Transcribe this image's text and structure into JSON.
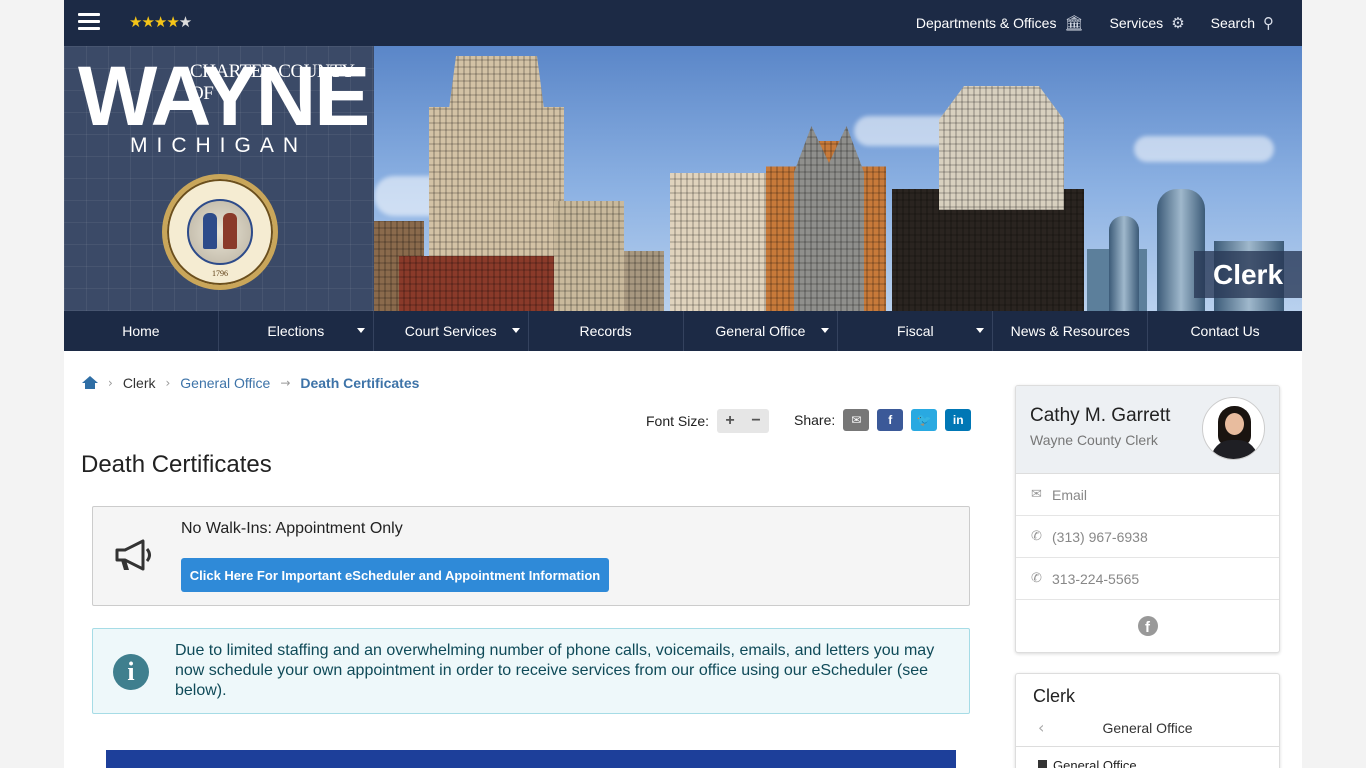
{
  "topbar": {
    "rating": {
      "stars": 4.5,
      "max": 5
    },
    "links": [
      {
        "label": "Departments & Offices",
        "icon": "bank-icon"
      },
      {
        "label": "Services",
        "icon": "gears-icon"
      },
      {
        "label": "Search",
        "icon": "search-icon"
      }
    ]
  },
  "hero": {
    "logo_charter": "CHARTER COUNTY OF",
    "logo_wayne": "WAYNE",
    "logo_michigan": "MICHIGAN",
    "seal_year": "1796",
    "page_label": "Clerk"
  },
  "mainnav": {
    "items": [
      {
        "label": "Home",
        "dropdown": false
      },
      {
        "label": "Elections",
        "dropdown": true
      },
      {
        "label": "Court Services",
        "dropdown": true
      },
      {
        "label": "Records",
        "dropdown": false
      },
      {
        "label": "General Office",
        "dropdown": true
      },
      {
        "label": "Fiscal",
        "dropdown": true
      },
      {
        "label": "News & Resources",
        "dropdown": false
      },
      {
        "label": "Contact Us",
        "dropdown": false
      }
    ]
  },
  "breadcrumb": {
    "items": [
      "Clerk",
      "General Office",
      "Death Certificates"
    ]
  },
  "tools": {
    "font_size_label": "Font Size:",
    "plus": "+",
    "minus": "−",
    "share_label": "Share:",
    "share_buttons": [
      {
        "name": "email-icon",
        "glyph": "✉",
        "color": "#777777"
      },
      {
        "name": "facebook-icon",
        "glyph": "f",
        "color": "#3b5998"
      },
      {
        "name": "twitter-icon",
        "glyph": "t",
        "color": "#29a9e1"
      },
      {
        "name": "linkedin-icon",
        "glyph": "in",
        "color": "#0077b5"
      }
    ]
  },
  "main": {
    "title": "Death Certificates",
    "alert_title": "No Walk-Ins: Appointment Only",
    "alert_button": "Click Here For Important eScheduler and Appointment Information",
    "info_text": "Due to limited staffing and an overwhelming number of phone calls, voicemails, emails, and letters you may now schedule your own appointment in order to receive services from our office using our eScheduler (see below)."
  },
  "sidebar": {
    "name": "Cathy M. Garrett",
    "role": "Wayne County Clerk",
    "email_label": "Email",
    "phone1": "(313) 967-6938",
    "phone2": "313-224-5565",
    "section_title": "Clerk",
    "section_sub": "General Office",
    "section_item": "General Office"
  },
  "colors": {
    "navy": "#1c2a45",
    "link": "#3d73a8",
    "button": "#2f8ad8",
    "info_bg": "#eef8fa"
  }
}
